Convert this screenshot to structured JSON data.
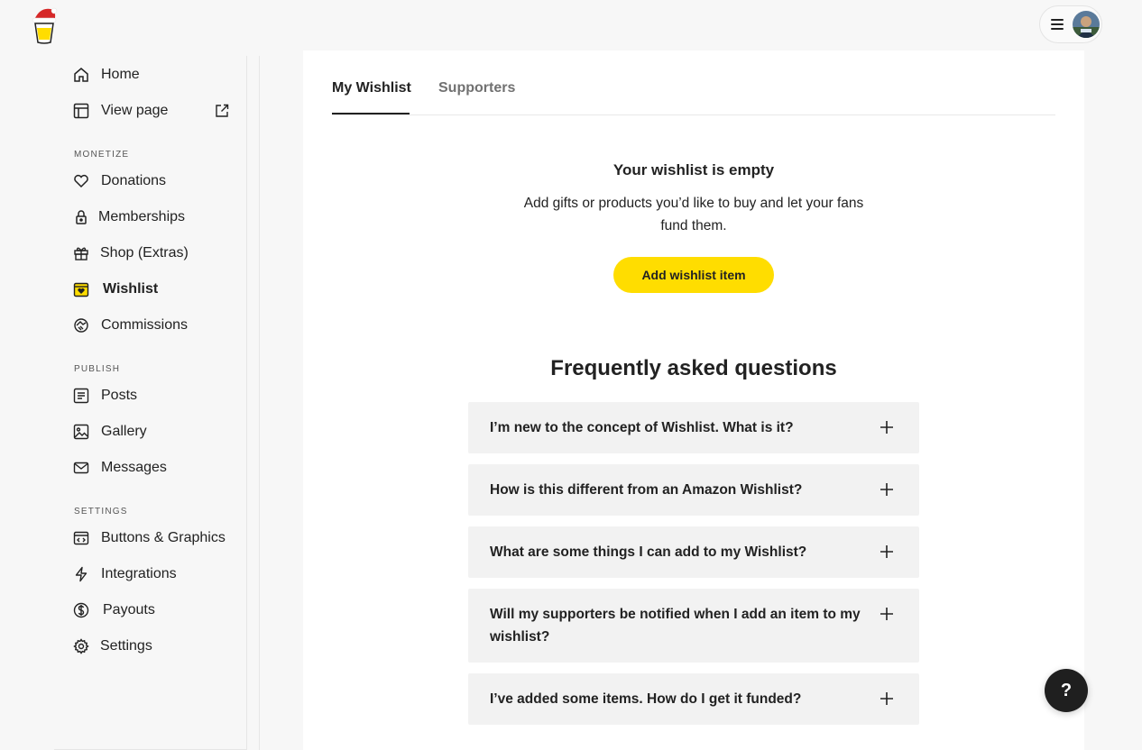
{
  "header": {
    "logo_icon": "coffee-cup-santa-hat-logo",
    "menu_icon": "hamburger-icon",
    "avatar_icon": "user-avatar"
  },
  "sidebar": {
    "top_items": [
      {
        "label": "Home",
        "icon": "home-icon"
      },
      {
        "label": "View page",
        "icon": "layout-icon",
        "trailing_icon": "external-link-icon"
      }
    ],
    "sections": [
      {
        "label": "MONETIZE",
        "items": [
          {
            "label": "Donations",
            "icon": "heart-icon"
          },
          {
            "label": "Memberships",
            "icon": "lock-icon"
          },
          {
            "label": "Shop (Extras)",
            "icon": "gift-icon"
          },
          {
            "label": "Wishlist",
            "icon": "wishlist-icon",
            "active": true
          },
          {
            "label": "Commissions",
            "icon": "handshake-icon"
          }
        ]
      },
      {
        "label": "PUBLISH",
        "items": [
          {
            "label": "Posts",
            "icon": "document-icon"
          },
          {
            "label": "Gallery",
            "icon": "image-icon"
          },
          {
            "label": "Messages",
            "icon": "mail-icon"
          }
        ]
      },
      {
        "label": "SETTINGS",
        "items": [
          {
            "label": "Buttons & Graphics",
            "icon": "code-window-icon"
          },
          {
            "label": "Integrations",
            "icon": "lightning-icon"
          },
          {
            "label": "Payouts",
            "icon": "dollar-icon"
          },
          {
            "label": "Settings",
            "icon": "gear-icon"
          }
        ]
      }
    ]
  },
  "tabs": [
    {
      "label": "My Wishlist",
      "active": true
    },
    {
      "label": "Supporters",
      "active": false
    }
  ],
  "empty_state": {
    "title": "Your wishlist is empty",
    "description": "Add gifts or products you’d like to buy and let your fans fund them.",
    "button_label": "Add wishlist item"
  },
  "faq": {
    "title": "Frequently asked questions",
    "items": [
      "I’m new to the concept of Wishlist. What is it?",
      "How is this different from an Amazon Wishlist?",
      "What are some things I can add to my Wishlist?",
      "Will my supporters be notified when I add an item to my wishlist?",
      "I’ve added some items. How do I get it funded?"
    ]
  },
  "help_button": {
    "label": "?"
  },
  "colors": {
    "accent": "#ffdd00",
    "background": "#f7f7f7",
    "panel": "#ffffff",
    "faq_bg": "#f2f2f2",
    "dark": "#222222"
  }
}
